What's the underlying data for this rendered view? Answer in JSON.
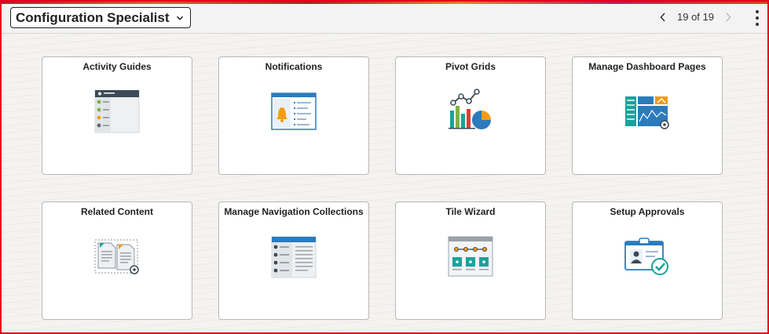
{
  "header": {
    "title": "Configuration Specialist",
    "pager_text": "19 of 19"
  },
  "icons": {
    "dropdown": "chevron-down-icon",
    "prev": "chevron-left-icon",
    "next": "chevron-right-icon",
    "menu": "more-vertical-icon"
  },
  "colors": {
    "frame_border": "#e5001d",
    "header_bg": "#f3f3f3",
    "teal": "#1aa39a",
    "blue": "#2b7bbd",
    "orange": "#f39c12"
  },
  "tiles": [
    {
      "label": "Activity Guides",
      "icon": "activity-guide-icon"
    },
    {
      "label": "Notifications",
      "icon": "notification-bell-icon"
    },
    {
      "label": "Pivot Grids",
      "icon": "pivot-chart-icon"
    },
    {
      "label": "Manage Dashboard Pages",
      "icon": "dashboard-icon"
    },
    {
      "label": "Related Content",
      "icon": "related-documents-icon"
    },
    {
      "label": "Manage Navigation Collections",
      "icon": "navigation-list-icon"
    },
    {
      "label": "Tile Wizard",
      "icon": "tile-wizard-icon"
    },
    {
      "label": "Setup Approvals",
      "icon": "approval-badge-icon"
    }
  ]
}
